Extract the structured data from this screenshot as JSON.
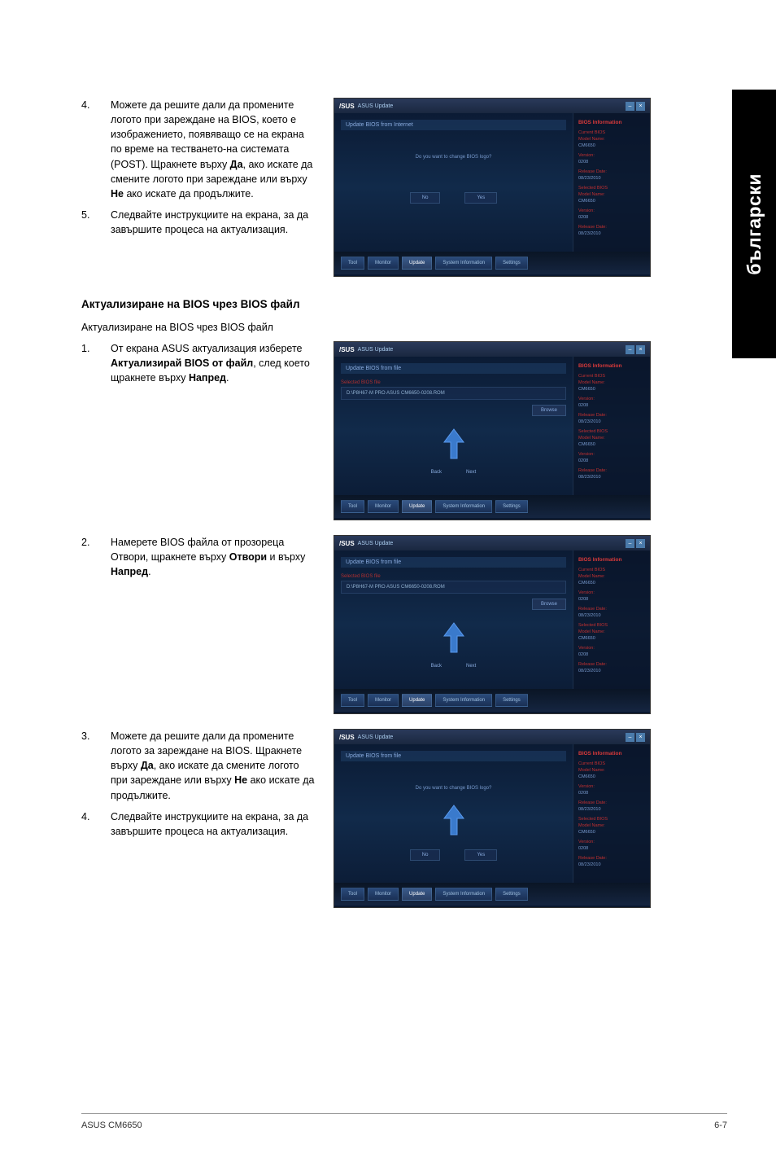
{
  "side_tab": "български",
  "section1": {
    "step4": {
      "num": "4.",
      "text_a": "Можете да решите дали да промените логото при зареждане на BIOS, което е изображението, появяващо се на екрана по време на тестването-на системата (POST). Щракнете върху ",
      "bold_yes": "Да",
      "text_b": ", ако искате да смените логото при зареждане или върху ",
      "bold_no": "Не",
      "text_c": " ако искате да продължите."
    },
    "step5": {
      "num": "5.",
      "text": "Следвайте инструкциите на екрана, за да завършите процеса на актуализация."
    }
  },
  "section2": {
    "heading": "Актуализиране на BIOS чрез BIOS файл",
    "intro": "Актуализиране на BIOS чрез BIOS файл",
    "step1": {
      "num": "1.",
      "text_a": "От екрана ASUS актуализация изберете ",
      "bold_a": "Актуализирай BIOS от файл",
      "text_b": ", след което щракнете върху ",
      "bold_b": "Напред",
      "text_c": "."
    },
    "step2": {
      "num": "2.",
      "text_a": "Намерете BIOS файла от прозореца Отвори, щракнете върху ",
      "bold_a": "Отвори",
      "text_b": " и върху ",
      "bold_b": "Напред",
      "text_c": "."
    },
    "step3": {
      "num": "3.",
      "text_a": "Можете да решите дали да промените логото за зареждане на BIOS. Щракнете върху ",
      "bold_yes": "Да",
      "text_b": ", ако искате да смените логото при зареждане или върху ",
      "bold_no": "Не",
      "text_c": " ако искате да продължите."
    },
    "step4": {
      "num": "4.",
      "text": "Следвайте инструкциите на екрана, за да завършите процеса на актуализация."
    }
  },
  "screens": {
    "logo": "/SUS",
    "title": "ASUS Update",
    "side_header": "BIOS Information",
    "side_items": {
      "cur_bios": "Current BIOS",
      "model": "Model Name:",
      "model_v": "CM6650",
      "ver": "Version:",
      "ver_v": "0208",
      "date": "Release Date:",
      "date_v": "08/23/2010",
      "new_bios": "Selected BIOS",
      "model2": "Model Name:",
      "model2_v": "CM6650",
      "ver2": "Version:",
      "ver2_v": "0208",
      "date2": "Release Date:",
      "date2_v": "08/23/2010"
    },
    "s1": {
      "sub": "Update BIOS from Internet",
      "center": "Do you want to change BIOS logo?",
      "no": "No",
      "yes": "Yes"
    },
    "s2": {
      "sub": "Update BIOS from file",
      "filebox": "Selected BIOS file",
      "path": "D:\\P8H67-M PRO ASUS CM6650-0208.ROM",
      "browse": "Browse",
      "back": "Back",
      "next": "Next"
    },
    "s3": {
      "sub": "Update BIOS from file",
      "filebox": "Selected BIOS file",
      "path": "D:\\P8H67-M PRO ASUS CM6650-0208.ROM",
      "browse": "Browse",
      "back": "Back",
      "next": "Next"
    },
    "s4": {
      "sub": "Update BIOS from file",
      "center": "Do you want to change BIOS logo?",
      "no": "No",
      "yes": "Yes"
    },
    "nav": {
      "tool": "Tool",
      "monitor": "Monitor",
      "update": "Update",
      "system": "System Information",
      "settings": "Settings"
    }
  },
  "footer": {
    "left": "ASUS CM6650",
    "right": "6-7"
  }
}
